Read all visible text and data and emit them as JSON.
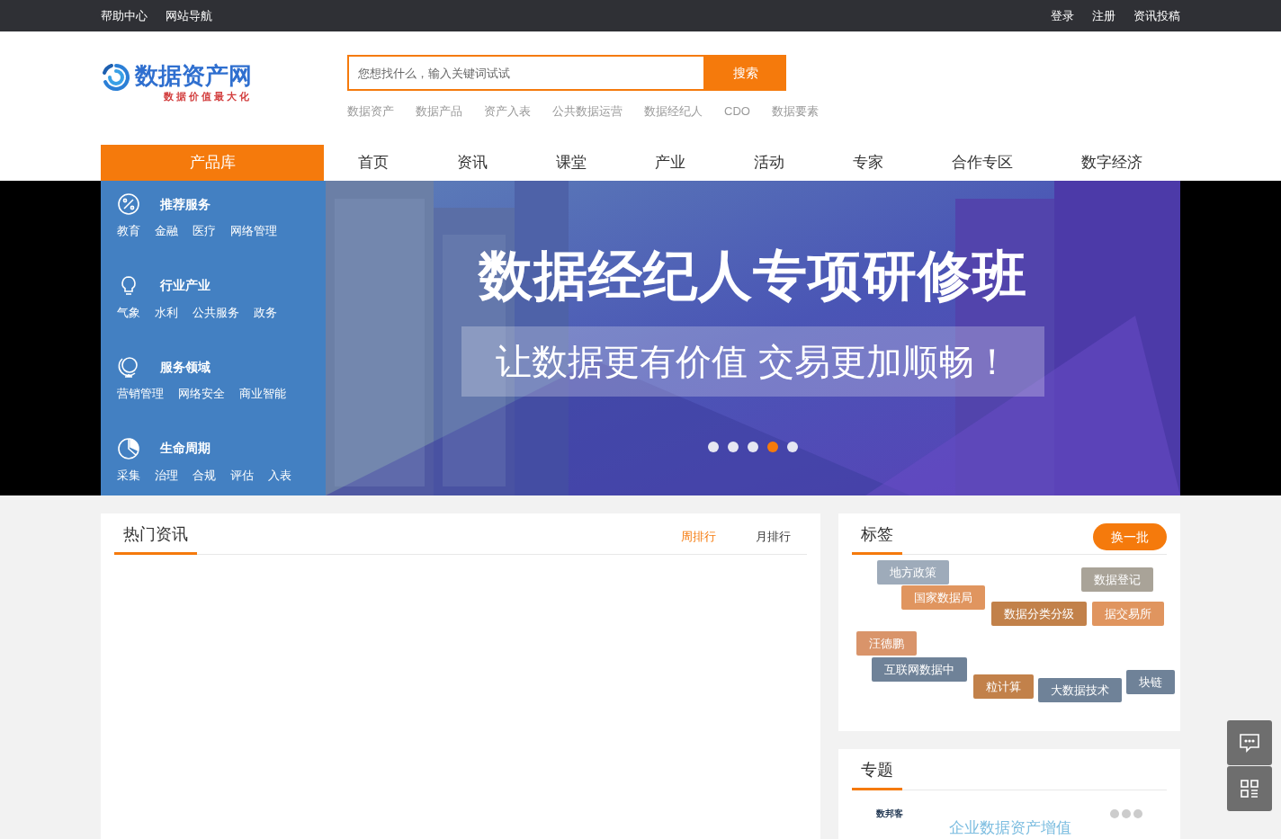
{
  "top_bar": {
    "left_links": [
      "帮助中心",
      "网站导航"
    ],
    "right_links": [
      "登录",
      "注册",
      "资讯投稿"
    ]
  },
  "logo": {
    "name": "数据资产网",
    "slogan": "数据价值最大化"
  },
  "search": {
    "placeholder": "您想找什么，输入关键词试试",
    "button": "搜索",
    "hot_words": [
      "数据资产",
      "数据产品",
      "资产入表",
      "公共数据运营",
      "数据经纪人",
      "CDO",
      "数据要素"
    ]
  },
  "nav": {
    "product_library": "产品库",
    "items": [
      "首页",
      "资讯",
      "课堂",
      "产业",
      "活动",
      "专家",
      "合作专区",
      "数字经济"
    ]
  },
  "categories": [
    {
      "kind": "percent",
      "title": "推荐服务",
      "links": [
        "教育",
        "金融",
        "医疗",
        "网络管理"
      ]
    },
    {
      "kind": "bulb",
      "title": "行业产业",
      "links": [
        "气象",
        "水利",
        "公共服务",
        "政务"
      ]
    },
    {
      "kind": "globe",
      "title": "服务领域",
      "links": [
        "营销管理",
        "网络安全",
        "商业智能"
      ]
    },
    {
      "kind": "pie",
      "title": "生命周期",
      "links": [
        "采集",
        "治理",
        "合规",
        "评估",
        "入表"
      ]
    }
  ],
  "banner": {
    "title": "数据经纪人专项研修班",
    "subtitle": "让数据更有价值 交易更加顺畅！",
    "dots": [
      {
        "selected": false
      },
      {
        "selected": false
      },
      {
        "selected": false
      },
      {
        "selected": true
      },
      {
        "selected": false
      }
    ]
  },
  "hot_news": {
    "title": "热门资讯",
    "tabs": [
      {
        "label": "周排行",
        "selected": true
      },
      {
        "label": "月排行",
        "selected": false
      }
    ]
  },
  "tags": {
    "title": "标签",
    "refresh": "换一批",
    "items": [
      {
        "text": "地方政策",
        "color": "#9eabba"
      },
      {
        "text": "国家数据局",
        "color": "#e0955f"
      },
      {
        "text": "数据登记",
        "color": "#a9a398"
      },
      {
        "text": "数据分类分级",
        "color": "#c2814a"
      },
      {
        "text": "据交易所",
        "color": "#e0955f"
      },
      {
        "text": "汪德鹏",
        "color": "#d9946a"
      },
      {
        "text": "互联网数据中",
        "color": "#6f8298"
      },
      {
        "text": "块链",
        "color": "#6f8298"
      },
      {
        "text": "粒计算",
        "color": "#c2814a"
      },
      {
        "text": "大数据技术",
        "color": "#6f8298"
      }
    ]
  },
  "topics": {
    "title": "专题",
    "card_brand": "数邦客",
    "card_title": "企业数据资产增值"
  }
}
